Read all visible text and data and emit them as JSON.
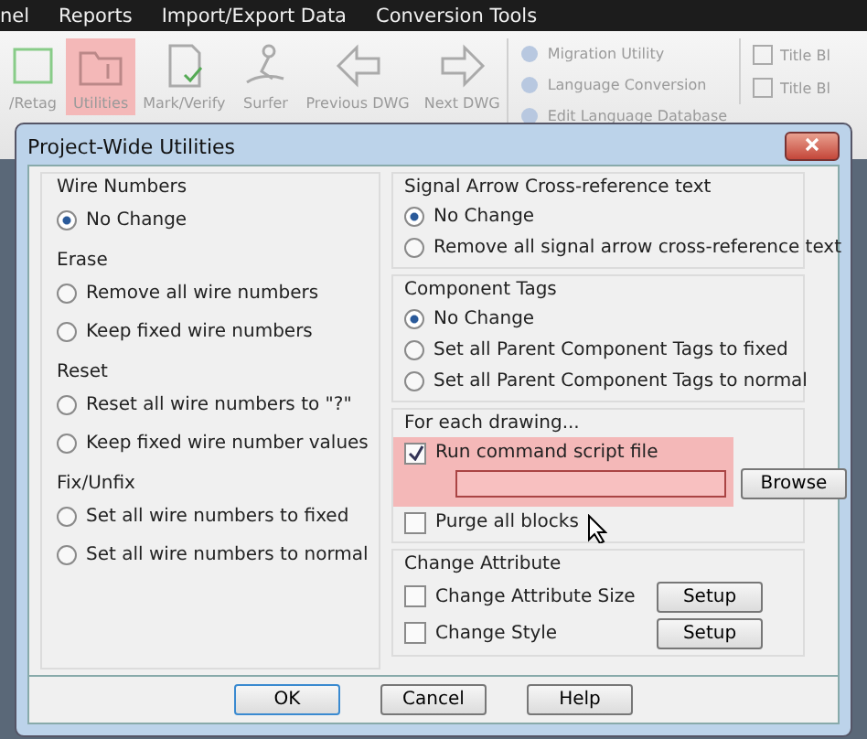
{
  "menu": [
    {
      "label": "nel"
    },
    {
      "label": "Reports"
    },
    {
      "label": "Import/Export Data"
    },
    {
      "label": "Conversion Tools"
    }
  ],
  "ribbon": [
    {
      "kind": "retag",
      "label": "/Retag",
      "highlighted": false
    },
    {
      "kind": "utilities",
      "label": "Utilities",
      "highlighted": true
    },
    {
      "kind": "verify",
      "label": "Mark/Verify",
      "highlighted": false
    },
    {
      "kind": "surfer",
      "label": "Surfer",
      "highlighted": false
    },
    {
      "kind": "prev",
      "label": "Previous DWG",
      "highlighted": false
    },
    {
      "kind": "next",
      "label": "Next DWG",
      "highlighted": false
    }
  ],
  "ribbon_small": [
    {
      "label": "Migration Utility"
    },
    {
      "label": "Language Conversion"
    },
    {
      "label": "Edit Language Database"
    }
  ],
  "ribbon_title": [
    {
      "label": "Title Bl"
    },
    {
      "label": "Title Bl"
    }
  ],
  "dialog": {
    "title": "Project-Wide Utilities",
    "left_sections": [
      {
        "title": "Wire Numbers",
        "options": [
          {
            "label": "No Change",
            "selected": true
          }
        ]
      },
      {
        "title": "Erase",
        "options": [
          {
            "label": "Remove all wire numbers",
            "selected": false
          },
          {
            "label": "Keep fixed wire numbers",
            "selected": false
          }
        ]
      },
      {
        "title": "Reset",
        "options": [
          {
            "label": "Reset all wire numbers to \"?\"",
            "selected": false
          },
          {
            "label": "Keep fixed wire number values",
            "selected": false
          }
        ]
      },
      {
        "title": "Fix/Unfix",
        "options": [
          {
            "label": "Set all wire numbers to fixed",
            "selected": false
          },
          {
            "label": "Set all wire numbers to normal",
            "selected": false
          }
        ]
      }
    ],
    "right_groups": [
      {
        "title": "Signal Arrow Cross-reference text",
        "options": [
          {
            "label": "No Change",
            "selected": true
          },
          {
            "label": "Remove all signal arrow cross-reference text",
            "selected": false
          }
        ]
      },
      {
        "title": "Component Tags",
        "options": [
          {
            "label": "No Change",
            "selected": true
          },
          {
            "label": "Set all Parent Component Tags to fixed",
            "selected": false
          },
          {
            "label": "Set all Parent Component Tags to normal",
            "selected": false
          }
        ]
      }
    ],
    "for_each_drawing": {
      "title": "For each drawing...",
      "run_script": {
        "label": "Run command script file",
        "checked": true,
        "highlighted": true
      },
      "browse": "Browse",
      "purge": {
        "label": "Purge all blocks",
        "checked": false
      }
    },
    "change_attribute": {
      "title": "Change Attribute",
      "items": [
        {
          "label": "Change Attribute Size",
          "checked": false,
          "button": "Setup"
        },
        {
          "label": "Change Style",
          "checked": false,
          "button": "Setup"
        }
      ]
    },
    "buttons": [
      {
        "label": "OK",
        "default": true
      },
      {
        "label": "Cancel",
        "default": false
      },
      {
        "label": "Help",
        "default": false
      }
    ]
  }
}
